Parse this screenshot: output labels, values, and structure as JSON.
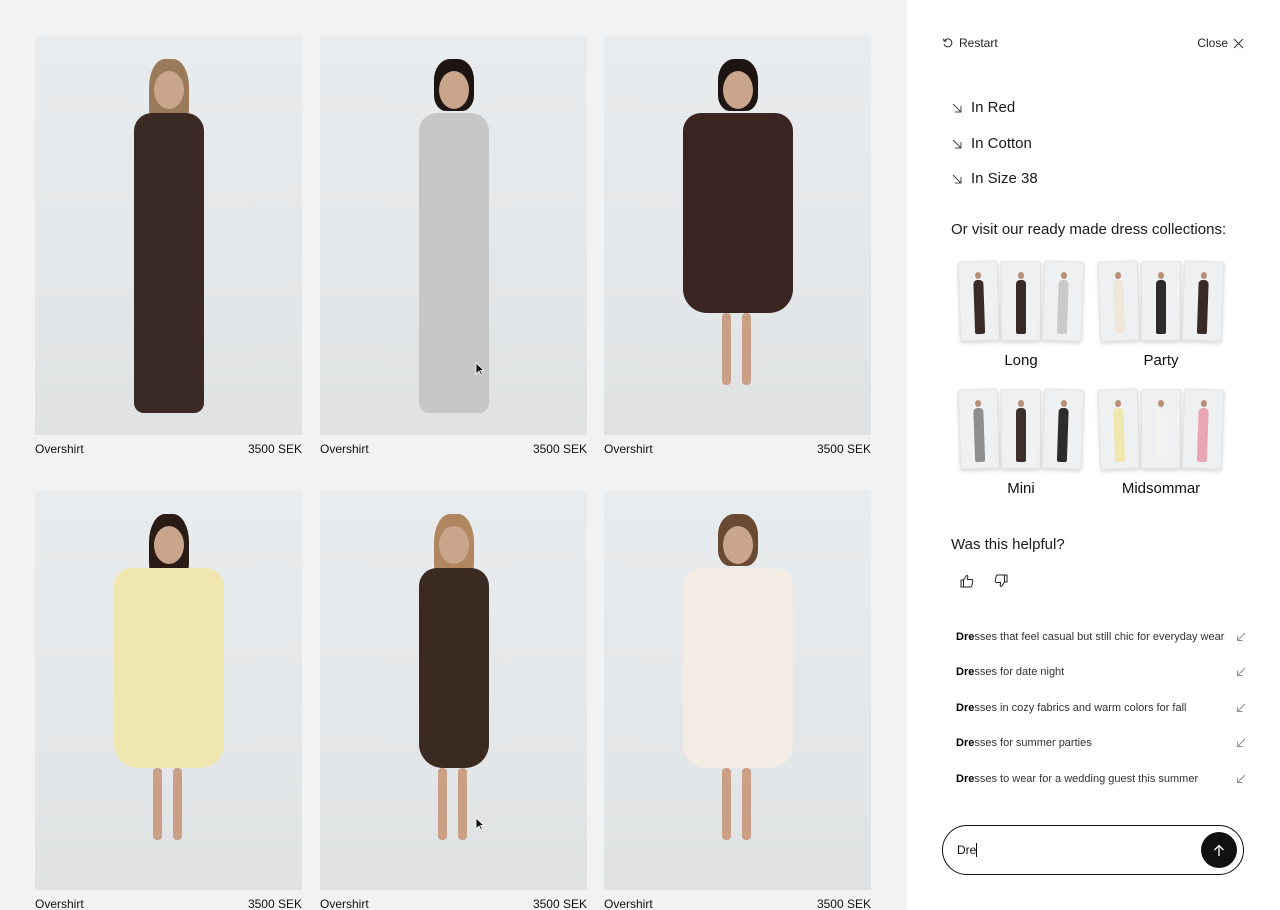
{
  "products": [
    {
      "name": "Overshirt",
      "price": "3500 SEK",
      "dress": "#3b2a24",
      "hair": "#9a7a5a",
      "skirt": "#2e211d"
    },
    {
      "name": "Overshirt",
      "price": "3500 SEK",
      "dress": "#c5c6c7",
      "hair": "#1e1512",
      "skirt": "#c5c6c7"
    },
    {
      "name": "Overshirt",
      "price": "3500 SEK",
      "dress": "#3a2520",
      "hair": "#1e1512",
      "skirt": "#3a2520"
    },
    {
      "name": "Overshirt",
      "price": "3500 SEK",
      "dress": "#f0e6b0",
      "hair": "#2a1b15",
      "skirt": "#f0e6b0"
    },
    {
      "name": "Overshirt",
      "price": "3500 SEK",
      "dress": "#3a2a22",
      "hair": "#b0875e",
      "skirt": "#3a2a22"
    },
    {
      "name": "Overshirt",
      "price": "3500 SEK",
      "dress": "#f2ece2",
      "hair": "#6b4a33",
      "skirt": "#f2ece2"
    }
  ],
  "panel": {
    "restart_label": "Restart",
    "close_label": "Close",
    "quick_filters": [
      "In Red",
      "In Cotton",
      "In Size 38"
    ],
    "collections_heading": "Or visit our ready made dress collections:",
    "collections": [
      {
        "label": "Long",
        "colors": [
          "#3a2b25",
          "#3a2a24",
          "#c9c9c9"
        ]
      },
      {
        "label": "Party",
        "colors": [
          "#eee7da",
          "#2e2a2a",
          "#3b2a24"
        ]
      },
      {
        "label": "Mini",
        "colors": [
          "#8e8e8e",
          "#3d3028",
          "#2c2c2c"
        ]
      },
      {
        "label": "Midsommar",
        "colors": [
          "#f0e6b0",
          "#f4f2ee",
          "#e8a6b0"
        ]
      }
    ],
    "helpful_question": "Was this helpful?",
    "suggestions": [
      {
        "match": "Dre",
        "rest": "sses that feel casual but still chic for everyday wear"
      },
      {
        "match": "Dre",
        "rest": "sses for date night"
      },
      {
        "match": "Dre",
        "rest": "sses in cozy fabrics and warm colors for fall"
      },
      {
        "match": "Dre",
        "rest": "sses for summer parties"
      },
      {
        "match": "Dre",
        "rest": "sses to wear for a wedding guest this summer"
      }
    ],
    "input_value": "Dre",
    "icons": {
      "restart": "restart-icon",
      "close": "close-icon",
      "suggest": "arrow-down-right-icon",
      "thumbs_up": "thumbs-up-icon",
      "thumbs_down": "thumbs-down-icon",
      "send": "arrow-up-icon"
    }
  }
}
